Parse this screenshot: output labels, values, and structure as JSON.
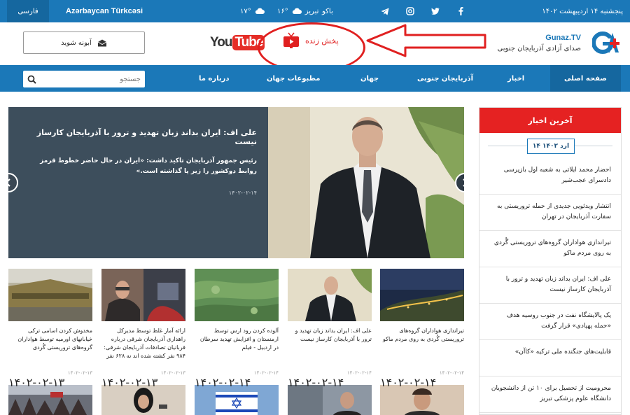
{
  "topbar": {
    "lang_fa": "فارسی",
    "lang_tr": "Azərbaycan Türkcəsi",
    "weather": [
      {
        "city": "",
        "temp": "۱۷°"
      },
      {
        "city": "تبریز",
        "temp": "۱۶°"
      },
      {
        "city": "باکو",
        "temp": ""
      }
    ],
    "date": "پنجشنبه ۱۴ اردیبهشت ۱۴۰۲",
    "social": [
      "telegram-icon",
      "instagram-icon",
      "twitter-icon",
      "facebook-icon"
    ]
  },
  "header": {
    "subscribe_label": "آبونه شوید",
    "youtube_you": "You",
    "youtube_tube": "Tube",
    "live_label": "پخش زنده",
    "brand_name": "Gunaz.TV",
    "brand_tagline": "صدای آزادی آذربایجان جنوبی"
  },
  "nav": {
    "search_placeholder": "جستجو",
    "items": [
      "صفحه اصلی",
      "اخبار",
      "آذربایجان جنوبی",
      "جهان",
      "مطبوعات جهان",
      "درباره ما"
    ]
  },
  "slider": {
    "title": "علی اف: ایران بداند زبان تهدید و ترور با آذربایجان کارساز نیست",
    "subtitle": "رئیس جمهور آذربایجان تاکید داشت: «ایران در حال حاضر خطوط قرمز روابط دوکشور را زیر پا گذاشته است.»",
    "date": "۱۴۰۲-۰۲-۱۴"
  },
  "cards": [
    {
      "title": "تیراندازی هواداران گروه‌های تروریستی گُردی به روی مردم ماکو",
      "date": "۱۴۰۲-۰۲-۱۴"
    },
    {
      "title": "علی اف: ایران بداند زبان تهدید و ترور با آذربایجان کارساز نیست",
      "date": "۱۴۰۲-۰۲-۱۴"
    },
    {
      "title": "آلوده کردن رود ارس توسط ارمنستان و افزایش تهدید سرطان در اردبیل - فیلم",
      "date": "۱۴۰۲-۰۲-۱۴"
    },
    {
      "title": "ارائه آمار غلط توسط مدیرکل راهداری آذربایجان شرقی درباره قربانیان تصادفات آذربایجان شرقی: ۹۸۴ نفر کشته شده اند نه ۶۲۸ نفر",
      "date": "۱۴۰۲-۰۲-۱۳"
    },
    {
      "title": "مخدوش کردن اسامی ترکی خیابانهای اورمیه توسط هواداران گروه‌های تروریستی گُردی",
      "date": "۱۴۰۲-۰۲-۱۳"
    }
  ],
  "sidebar": {
    "header": "آخرین اخبار",
    "date": "۱۴ ارد ۱۴۰۲",
    "items": [
      "احضار محمد ایلاتی به شعبه اول بازپرسی دادسرای عجب‌شیر",
      "انتشار ویدئویی جدیدی از حمله تروریستی به سفارت آذربایجان در تهران",
      "تیراندازی هواداران گروه‌های تروریستی گُردی به روی مردم ماکو",
      "علی اف: ایران بداند زبان تهدید و ترور با آذربایجان کارساز نیست",
      "یک پالایشگاه نفت در جنوب روسیه هدف «حمله پهپادی» قرار گرفت",
      "قابلیت‌های جنگنده ملی ترکیه «کاآن»",
      "محرومیت از تحصیل برای ۱۰ تن از دانشجویان دانشگاه علوم پزشکی تبریز"
    ]
  },
  "colors": {
    "primary": "#1b78b8",
    "primary_dark": "#15679f",
    "accent_red": "#e52222",
    "slider_bg": "#3d4e5c"
  }
}
